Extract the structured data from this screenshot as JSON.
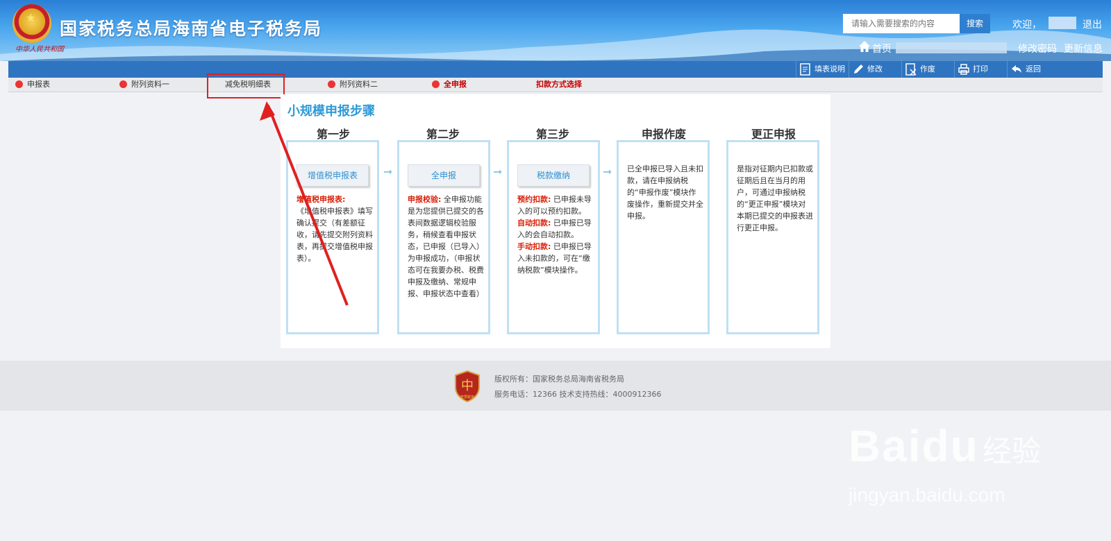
{
  "header": {
    "title": "国家税务总局海南省电子税务局",
    "seal_text": "中华人民共和国",
    "search_placeholder": "请输入需要搜索的内容",
    "search_button": "搜索",
    "welcome": "欢迎，",
    "logout": "退出",
    "home": "首页",
    "change_password": "修改密码",
    "update_info": "更新信息"
  },
  "toolbar": {
    "items": [
      {
        "label": "填表说明",
        "icon": "document-icon"
      },
      {
        "label": "修改",
        "icon": "pencil-icon"
      },
      {
        "label": "作废",
        "icon": "cancel-doc-icon"
      },
      {
        "label": "打印",
        "icon": "printer-icon"
      },
      {
        "label": "返回",
        "icon": "back-arrow-icon"
      }
    ]
  },
  "tabs": [
    {
      "label": "申报表"
    },
    {
      "label": "附列资料一"
    },
    {
      "label": "减免税明细表"
    },
    {
      "label": "附列资料二"
    },
    {
      "label": "全申报"
    },
    {
      "label": "扣款方式选择"
    }
  ],
  "steps": {
    "title": "小规模申报步骤",
    "columns": [
      {
        "header": "第一步",
        "badge": "增值税申报表",
        "lines": [
          {
            "strong": "增值税申报表:",
            "text": "《增值税申报表》填写确认提交（有差额征收，请先提交附列资料表，再提交增值税申报表）。"
          }
        ]
      },
      {
        "header": "第二步",
        "badge": "全申报",
        "lines": [
          {
            "strong": "申报校验:",
            "text": "全申报功能是为您提供已提交的各表间数据逻辑校验服务，稍候查看申报状态，已申报（已导入）为申报成功，（申报状态可在我要办税、税费申报及缴纳、常规申报、申报状态中查看）"
          }
        ]
      },
      {
        "header": "第三步",
        "badge": "税款缴纳",
        "lines": [
          {
            "strong": "预约扣款:",
            "text": "已申报未导入的可以预约扣款。"
          },
          {
            "strong": "自动扣款:",
            "text": "已申报已导入的会自动扣款。"
          },
          {
            "strong": "手动扣款:",
            "text": "已申报已导入未扣款的，可在“缴纳税款”模块操作。"
          }
        ]
      },
      {
        "header": "申报作废",
        "badge": "",
        "lines": [
          {
            "strong": "",
            "text": "已全申报已导入且未扣款，请在申报纳税的“申报作废”模块作废操作，重新提交并全申报。"
          }
        ]
      },
      {
        "header": "更正申报",
        "badge": "",
        "lines": [
          {
            "strong": "",
            "text": "是指对征期内已扣款或征期后且在当月的用户，可通过申报纳税的“更正申报”模块对本期已提交的申报表进行更正申报。"
          }
        ]
      }
    ]
  },
  "footer": {
    "logo_text": "智慧税务",
    "copyright": "版权所有：国家税务总局海南省税务局",
    "service": "服务电话：12366 技术支持热线：4000912366"
  },
  "watermark": {
    "brand": "Baidu",
    "cn": "经验",
    "url": "jingyan.baidu.com"
  },
  "colors": {
    "header_blue": "#2a7fd6",
    "toolbar_blue": "#2e74c0",
    "step_blue": "#2e9ad8",
    "highlight_red": "#e02020",
    "strong_red": "#d81e06"
  }
}
